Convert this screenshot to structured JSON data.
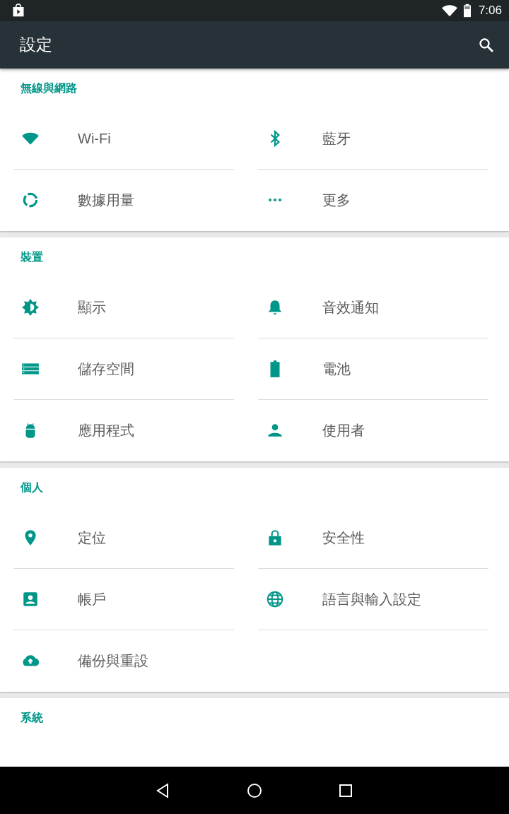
{
  "status_bar": {
    "time": "7:06"
  },
  "app_bar": {
    "title": "設定"
  },
  "sections": [
    {
      "title": "無線與網路",
      "items": [
        {
          "label": "Wi-Fi",
          "kind": "wifi"
        },
        {
          "label": "藍牙",
          "kind": "bluetooth"
        },
        {
          "label": "數據用量",
          "kind": "data"
        },
        {
          "label": "更多",
          "kind": "more"
        }
      ]
    },
    {
      "title": "裝置",
      "items": [
        {
          "label": "顯示",
          "kind": "brightness"
        },
        {
          "label": "音效通知",
          "kind": "bell"
        },
        {
          "label": "儲存空間",
          "kind": "storage"
        },
        {
          "label": "電池",
          "kind": "battery"
        },
        {
          "label": "應用程式",
          "kind": "android"
        },
        {
          "label": "使用者",
          "kind": "person"
        }
      ]
    },
    {
      "title": "個人",
      "items": [
        {
          "label": "定位",
          "kind": "location"
        },
        {
          "label": "安全性",
          "kind": "lock"
        },
        {
          "label": "帳戶",
          "kind": "account"
        },
        {
          "label": "語言與輸入設定",
          "kind": "globe"
        },
        {
          "label": "備份與重設",
          "kind": "cloud"
        }
      ]
    },
    {
      "title": "系統"
    }
  ]
}
